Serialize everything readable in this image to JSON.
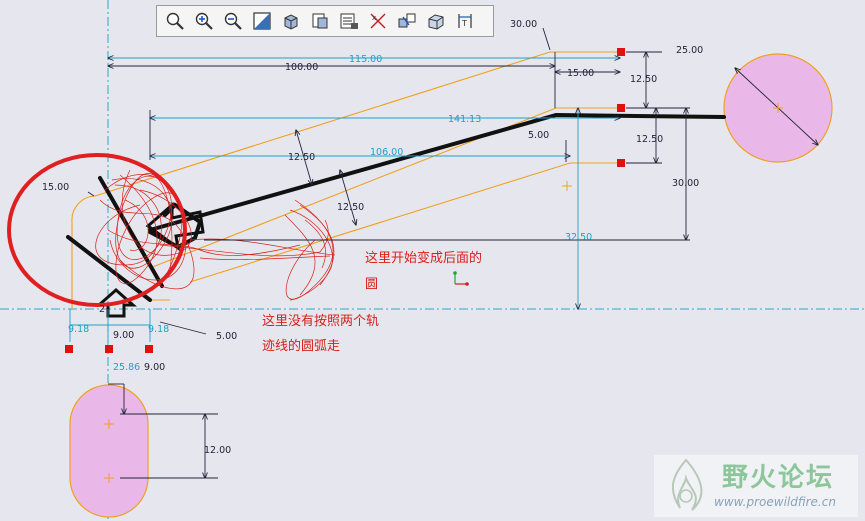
{
  "toolbar": {
    "buttons": [
      {
        "name": "zoom-fit-button",
        "icon": "zoom-fit-icon"
      },
      {
        "name": "zoom-in-button",
        "icon": "zoom-in-icon"
      },
      {
        "name": "zoom-out-button",
        "icon": "zoom-out-icon"
      },
      {
        "name": "repaint-button",
        "icon": "repaint-icon"
      },
      {
        "name": "display-style-button",
        "icon": "shaded-cube-icon"
      },
      {
        "name": "saved-views-button",
        "icon": "saved-views-icon"
      },
      {
        "name": "layer-tree-button",
        "icon": "layer-tree-icon"
      },
      {
        "name": "datum-display-button",
        "icon": "datum-display-icon"
      },
      {
        "name": "relations-button",
        "icon": "relations-icon"
      },
      {
        "name": "shading-button",
        "icon": "shading-icon"
      },
      {
        "name": "dimension-display-button",
        "icon": "dimension-display-icon"
      }
    ]
  },
  "dimensions": {
    "d115": "115.00",
    "d100": "100.00",
    "d30_top": "30.00",
    "d15_top": "15.00",
    "d12_50_a": "12.50",
    "d12_50_b": "12.50",
    "d25": "25.00",
    "d141_13": "141.13",
    "d106": "106.00",
    "d5_mid": "5.00",
    "d12_50_c": "12.50",
    "d12_50_d": "12.50",
    "d30_right": "30.00",
    "d32_50": "32.50",
    "d15_left": "15.00",
    "d2": "2",
    "d9_18_a": "9.18",
    "d9_18_b": "9.18",
    "d9_00_a": "9.00",
    "d9_00_b": "9.00",
    "d5_low": "5.00",
    "d25_86": "25.86",
    "d12_low": "12.00"
  },
  "annotations": {
    "note_arc_line1": "这里开始变成后面的",
    "note_arc_line2": "圆",
    "note_path_line1": "这里没有按照两个轨",
    "note_path_line2": "迹线的圆弧走"
  },
  "watermark": {
    "title": "野火论坛",
    "url": "www.proewildfire.cn"
  },
  "colors": {
    "background": "#e6e7ee",
    "sketch_orange": "#f0a020",
    "dimension": "#23233a",
    "dimension_cyan": "#1fa0c8",
    "fill_pink": "#eab8e8",
    "annotation_red": "#d8201a",
    "centerline": "#2aa8c8"
  }
}
